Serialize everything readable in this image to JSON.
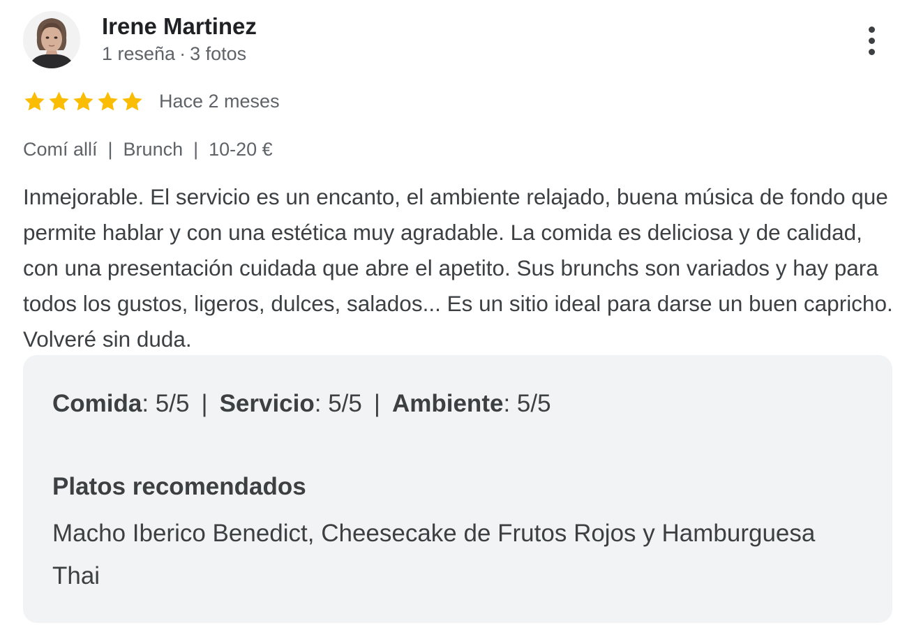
{
  "author": {
    "name": "Irene Martinez",
    "reviews": "1 reseña",
    "meta_separator": "·",
    "photos": "3 fotos",
    "avatar_icon": "user-photo"
  },
  "more_menu": {
    "icon": "more-vertical-icon"
  },
  "rating": {
    "stars": 5,
    "max_stars": 5,
    "star_color": "#fbbc04",
    "date": "Hace 2 meses"
  },
  "tags": {
    "service_type": "Comí allí",
    "meal_type": "Brunch",
    "price": "10-20 €",
    "separator": "|"
  },
  "review_text": "Inmejorable. El servicio es un encanto, el ambiente relajado, buena música de fondo que permite hablar y con una estética muy agradable. La comida es deliciosa y de calidad, con una presentación cuidada que abre el apetito. Sus brunchs son variados y hay para todos los gustos, ligeros, dulces, salados... Es un sitio ideal para darse un buen capricho. Volveré sin duda.",
  "details": {
    "separator": "|",
    "food": {
      "label": "Comida",
      "value": ": 5/5"
    },
    "service": {
      "label": "Servicio",
      "value": ": 5/5"
    },
    "atmosphere": {
      "label": "Ambiente",
      "value": ": 5/5"
    },
    "recommended_title": "Platos recomendados",
    "recommended_dishes": "Macho Iberico Benedict, Cheesecake de Frutos Rojos y Hamburguesa Thai",
    "background_color": "#f1f3f4"
  }
}
